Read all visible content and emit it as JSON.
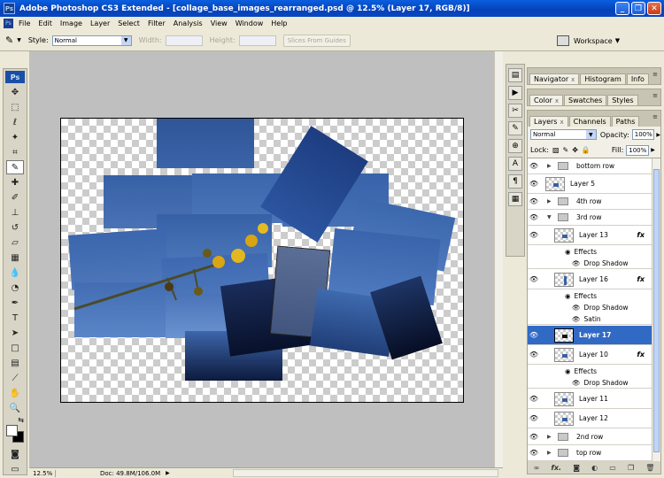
{
  "window": {
    "title": "Adobe Photoshop CS3 Extended - [collage_base_images_rearranged.psd @ 12.5% (Layer 17, RGB/8)]",
    "ps_icon": "Ps"
  },
  "menu": [
    "File",
    "Edit",
    "Image",
    "Layer",
    "Select",
    "Filter",
    "Analysis",
    "View",
    "Window",
    "Help"
  ],
  "options": {
    "style_label": "Style:",
    "style_value": "Normal",
    "width_label": "Width:",
    "height_label": "Height:",
    "slices_button": "Slices From Guides",
    "workspace_label": "Workspace"
  },
  "toolbox": {
    "logo": "Ps"
  },
  "status": {
    "zoom": "12.5%",
    "doc": "Doc: 49.8M/106.0M"
  },
  "panels": {
    "navigator_tabs": [
      "Navigator",
      "Histogram",
      "Info"
    ],
    "color_tabs": [
      "Color",
      "Swatches",
      "Styles"
    ],
    "layers_tabs": [
      "Layers",
      "Channels",
      "Paths"
    ],
    "blend_mode": "Normal",
    "opacity_label": "Opacity:",
    "opacity_value": "100%",
    "lock_label": "Lock:",
    "fill_label": "Fill:",
    "fill_value": "100%"
  },
  "layers": [
    {
      "name": "bottom row",
      "type": "group"
    },
    {
      "name": "Layer 5",
      "type": "layer"
    },
    {
      "name": "4th row",
      "type": "group"
    },
    {
      "name": "3rd row",
      "type": "group-open"
    },
    {
      "name": "Layer 13",
      "type": "layer",
      "fx": "fx"
    },
    {
      "name": "Effects",
      "type": "effects"
    },
    {
      "name": "Drop Shadow",
      "type": "effect"
    },
    {
      "name": "Layer 16",
      "type": "layer",
      "fx": "fx"
    },
    {
      "name": "Effects",
      "type": "effects"
    },
    {
      "name": "Drop Shadow",
      "type": "effect"
    },
    {
      "name": "Satin",
      "type": "effect"
    },
    {
      "name": "Layer 17",
      "type": "layer",
      "selected": true
    },
    {
      "name": "Layer 10",
      "type": "layer",
      "fx": "fx"
    },
    {
      "name": "Effects",
      "type": "effects"
    },
    {
      "name": "Drop Shadow",
      "type": "effect"
    },
    {
      "name": "Layer 11",
      "type": "layer"
    },
    {
      "name": "Layer 12",
      "type": "layer"
    },
    {
      "name": "2nd row",
      "type": "group"
    },
    {
      "name": "top row",
      "type": "group"
    }
  ]
}
